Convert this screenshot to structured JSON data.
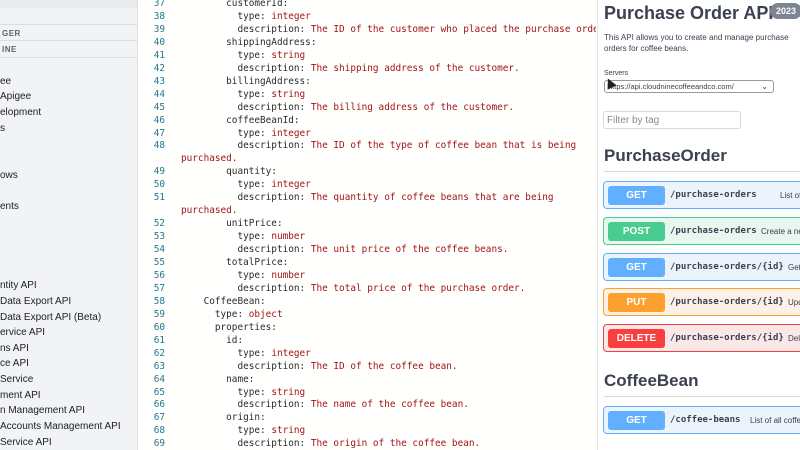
{
  "sidebar": {
    "sections": [
      "GER",
      "INE"
    ],
    "items": [
      "ee",
      "Apigee",
      "elopment",
      "s",
      "ows",
      "ents",
      "ntity API",
      "Data Export API",
      "Data Export API (Beta)",
      "ervice API",
      "ns API",
      "ce API",
      "Service",
      "ment API",
      "n Management API",
      "Accounts Management API",
      "Service API"
    ]
  },
  "editor": {
    "lines": [
      {
        "n": "37",
        "code": [
          {
            "t": "k",
            "s": "        customerId:"
          }
        ]
      },
      {
        "n": "38",
        "code": [
          {
            "t": "k",
            "s": "          type: "
          },
          {
            "t": "v",
            "s": "integer"
          }
        ]
      },
      {
        "n": "39",
        "code": [
          {
            "t": "k",
            "s": "          description: "
          },
          {
            "t": "v",
            "s": "The ID of the customer who placed the purchase order."
          }
        ]
      },
      {
        "n": "40",
        "code": [
          {
            "t": "k",
            "s": "        shippingAddress:"
          }
        ]
      },
      {
        "n": "41",
        "code": [
          {
            "t": "k",
            "s": "          type: "
          },
          {
            "t": "v",
            "s": "string"
          }
        ]
      },
      {
        "n": "42",
        "code": [
          {
            "t": "k",
            "s": "          description: "
          },
          {
            "t": "v",
            "s": "The shipping address of the customer."
          }
        ]
      },
      {
        "n": "43",
        "code": [
          {
            "t": "k",
            "s": "        billingAddress:"
          }
        ]
      },
      {
        "n": "44",
        "code": [
          {
            "t": "k",
            "s": "          type: "
          },
          {
            "t": "v",
            "s": "string"
          }
        ]
      },
      {
        "n": "45",
        "code": [
          {
            "t": "k",
            "s": "          description: "
          },
          {
            "t": "v",
            "s": "The billing address of the customer."
          }
        ]
      },
      {
        "n": "46",
        "code": [
          {
            "t": "k",
            "s": "        coffeeBeanId:"
          }
        ]
      },
      {
        "n": "47",
        "code": [
          {
            "t": "k",
            "s": "          type: "
          },
          {
            "t": "v",
            "s": "integer"
          }
        ]
      },
      {
        "n": "48",
        "code": [
          {
            "t": "k",
            "s": "          description: "
          },
          {
            "t": "v",
            "s": "The ID of the type of coffee bean that is being"
          }
        ]
      },
      {
        "n": "",
        "code": [
          {
            "t": "w",
            "s": "purchased."
          }
        ]
      },
      {
        "n": "49",
        "code": [
          {
            "t": "k",
            "s": "        quantity:"
          }
        ]
      },
      {
        "n": "50",
        "code": [
          {
            "t": "k",
            "s": "          type: "
          },
          {
            "t": "v",
            "s": "integer"
          }
        ]
      },
      {
        "n": "51",
        "code": [
          {
            "t": "k",
            "s": "          description: "
          },
          {
            "t": "v",
            "s": "The quantity of coffee beans that are being"
          }
        ]
      },
      {
        "n": "",
        "code": [
          {
            "t": "w",
            "s": "purchased."
          }
        ]
      },
      {
        "n": "52",
        "code": [
          {
            "t": "k",
            "s": "        unitPrice:"
          }
        ]
      },
      {
        "n": "53",
        "code": [
          {
            "t": "k",
            "s": "          type: "
          },
          {
            "t": "v",
            "s": "number"
          }
        ]
      },
      {
        "n": "54",
        "code": [
          {
            "t": "k",
            "s": "          description: "
          },
          {
            "t": "v",
            "s": "The unit price of the coffee beans."
          }
        ]
      },
      {
        "n": "55",
        "code": [
          {
            "t": "k",
            "s": "        totalPrice:"
          }
        ]
      },
      {
        "n": "56",
        "code": [
          {
            "t": "k",
            "s": "          type: "
          },
          {
            "t": "v",
            "s": "number"
          }
        ]
      },
      {
        "n": "57",
        "code": [
          {
            "t": "k",
            "s": "          description: "
          },
          {
            "t": "v",
            "s": "The total price of the purchase order."
          }
        ]
      },
      {
        "n": "58",
        "code": [
          {
            "t": "k",
            "s": "    CoffeeBean:"
          }
        ]
      },
      {
        "n": "59",
        "code": [
          {
            "t": "k",
            "s": "      type: "
          },
          {
            "t": "v",
            "s": "object"
          }
        ]
      },
      {
        "n": "60",
        "code": [
          {
            "t": "k",
            "s": "      properties:"
          }
        ]
      },
      {
        "n": "61",
        "code": [
          {
            "t": "k",
            "s": "        id:"
          }
        ]
      },
      {
        "n": "62",
        "code": [
          {
            "t": "k",
            "s": "          type: "
          },
          {
            "t": "v",
            "s": "integer"
          }
        ]
      },
      {
        "n": "63",
        "code": [
          {
            "t": "k",
            "s": "          description: "
          },
          {
            "t": "v",
            "s": "The ID of the coffee bean."
          }
        ]
      },
      {
        "n": "64",
        "code": [
          {
            "t": "k",
            "s": "        name:"
          }
        ]
      },
      {
        "n": "65",
        "code": [
          {
            "t": "k",
            "s": "          type: "
          },
          {
            "t": "v",
            "s": "string"
          }
        ]
      },
      {
        "n": "66",
        "code": [
          {
            "t": "k",
            "s": "          description: "
          },
          {
            "t": "v",
            "s": "The name of the coffee bean."
          }
        ]
      },
      {
        "n": "67",
        "code": [
          {
            "t": "k",
            "s": "        origin:"
          }
        ]
      },
      {
        "n": "68",
        "code": [
          {
            "t": "k",
            "s": "          type: "
          },
          {
            "t": "v",
            "s": "string"
          }
        ]
      },
      {
        "n": "69",
        "code": [
          {
            "t": "k",
            "s": "          description: "
          },
          {
            "t": "v",
            "s": "The origin of the coffee bean."
          }
        ]
      }
    ]
  },
  "swagger": {
    "title": "Purchase Order API",
    "version": "2023",
    "description": "This API allows you to create and manage purchase orders for coffee beans.",
    "servers_label": "Servers",
    "server_url": "https://api.cloudninecoffeeandco.com/",
    "filter_placeholder": "Filter by tag",
    "tags": [
      {
        "name": "PurchaseOrder",
        "operations": [
          {
            "method": "GET",
            "path": "/purchase-orders",
            "summary": "List of all purchase orders"
          },
          {
            "method": "POST",
            "path": "/purchase-orders",
            "summary": "Create a new purchase order"
          },
          {
            "method": "GET",
            "path": "/purchase-orders/{id}",
            "summary": "Get a purchase order"
          },
          {
            "method": "PUT",
            "path": "/purchase-orders/{id}",
            "summary": "Update a purchase order"
          },
          {
            "method": "DELETE",
            "path": "/purchase-orders/{id}",
            "summary": "Delete a purchase order"
          }
        ]
      },
      {
        "name": "CoffeeBean",
        "operations": [
          {
            "method": "GET",
            "path": "/coffee-beans",
            "summary": "List of all coffee beans"
          }
        ]
      }
    ]
  }
}
